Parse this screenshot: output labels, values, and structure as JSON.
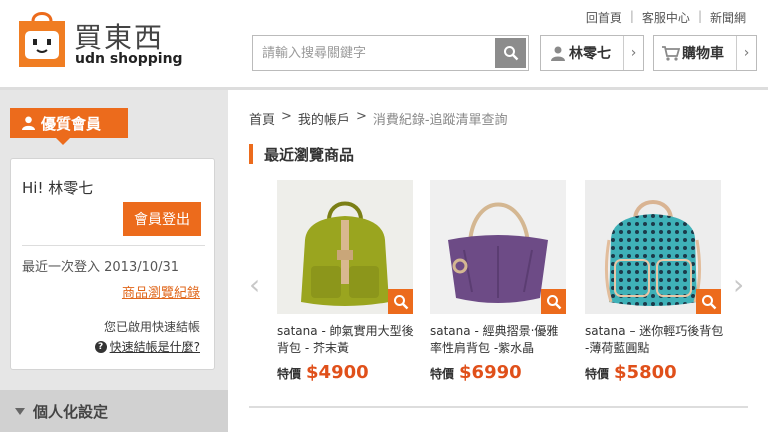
{
  "header": {
    "logo_cn": "買東西",
    "logo_en": "udn shopping",
    "links": [
      "回首頁",
      "客服中心",
      "新聞網"
    ],
    "search_placeholder": "請輸入搜尋關鍵字",
    "member_name": "林零七",
    "cart_label": "購物車"
  },
  "sidebar": {
    "vip_label": "優質會員",
    "greeting": "Hi! 林零七",
    "logout_label": "會員登出",
    "last_login": "最近一次登入 2013/10/31",
    "browse_history": "商品瀏覽紀錄",
    "quick_checkout": "您已啟用快速結帳",
    "quick_help": "快速結帳是什麼?",
    "personal_settings": "個人化設定"
  },
  "main": {
    "breadcrumb": [
      "首頁",
      "我的帳戶",
      "消費紀錄-追蹤清單查詢"
    ],
    "section_title": "最近瀏覽商品",
    "price_label": "特價",
    "products": [
      {
        "name": "satana - 帥氣實用大型後背包 - 芥末黃",
        "price": "$4900",
        "color": "#9aa51f"
      },
      {
        "name": "satana - 經典摺景‧優雅率性肩背包 -紫水晶",
        "price": "$6990",
        "color": "#6d4b86"
      },
      {
        "name": "satana – 迷你輕巧後背包 -薄荷藍圓點",
        "price": "$5800",
        "color": "#3fb1b8"
      }
    ]
  },
  "colors": {
    "accent": "#ec6b1c",
    "price": "#e0501a"
  }
}
